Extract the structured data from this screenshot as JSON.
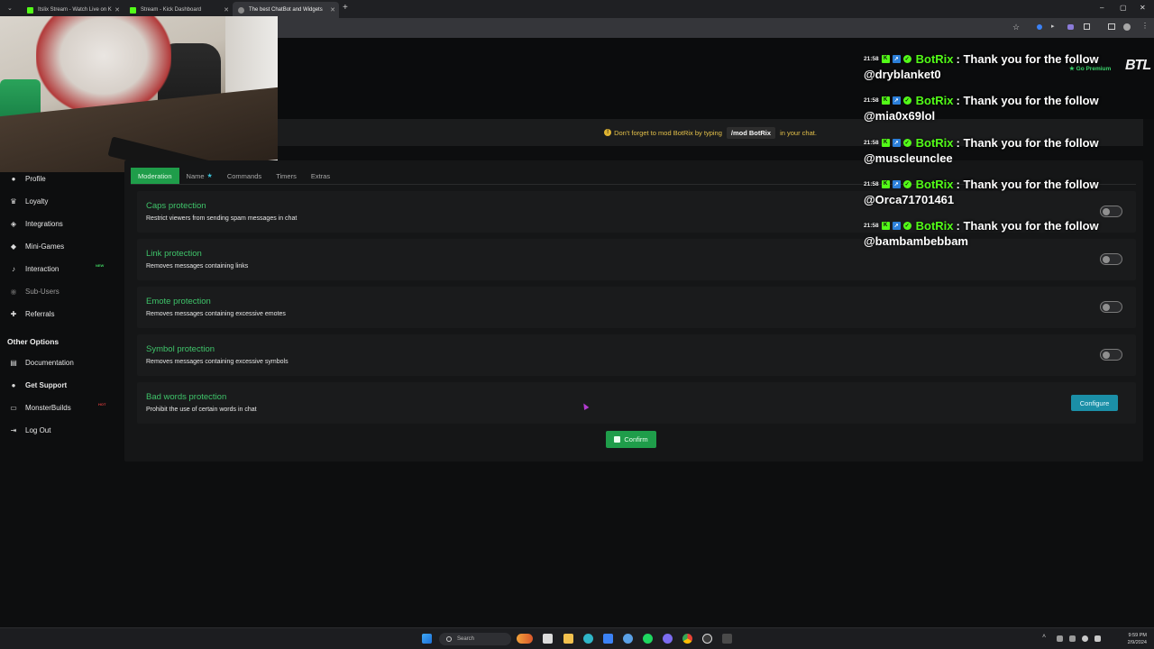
{
  "browser": {
    "tabs": [
      {
        "label": "Itslix Stream - Watch Live on K",
        "color": "#53fc18"
      },
      {
        "label": "Stream - Kick Dashboard",
        "color": "#53fc18"
      },
      {
        "label": "The best ChatBot and Widgets",
        "color": "#888888"
      }
    ],
    "new_tab": "+",
    "window_controls": {
      "minimize": "–",
      "maximize": "▢",
      "close": "✕"
    }
  },
  "notice": {
    "prefix": "Don't forget to mod BotRix by typing",
    "command": "/mod BotRix",
    "suffix": "in your chat."
  },
  "sidebar": {
    "items": [
      {
        "label": "Profile",
        "icon": "user-icon",
        "glyph": "●"
      },
      {
        "label": "Loyalty",
        "icon": "trophy-icon",
        "glyph": "♛"
      },
      {
        "label": "Integrations",
        "icon": "plug-icon",
        "glyph": "◈"
      },
      {
        "label": "Mini-Games",
        "icon": "gamepad-icon",
        "glyph": "◆"
      },
      {
        "label": "Interaction",
        "icon": "music-icon",
        "glyph": "♪",
        "badge": "NEW"
      },
      {
        "label": "Sub-Users",
        "icon": "users-icon",
        "glyph": "◉"
      },
      {
        "label": "Referrals",
        "icon": "people-icon",
        "glyph": "✚"
      }
    ],
    "other_options_title": "Other Options",
    "other_items": [
      {
        "label": "Documentation",
        "icon": "book-icon",
        "glyph": "▤"
      },
      {
        "label": "Get Support",
        "icon": "support-icon",
        "glyph": "●"
      },
      {
        "label": "MonsterBuilds",
        "icon": "monitor-icon",
        "glyph": "▭",
        "badge": "HOT"
      },
      {
        "label": "Log Out",
        "icon": "logout-icon",
        "glyph": "⇥"
      }
    ]
  },
  "tabs": [
    {
      "label": "Moderation",
      "active": true
    },
    {
      "label": "Name",
      "star": "★"
    },
    {
      "label": "Commands"
    },
    {
      "label": "Timers"
    },
    {
      "label": "Extras"
    }
  ],
  "settings": [
    {
      "title": "Caps protection",
      "desc": "Restrict viewers from sending spam messages in chat",
      "control": "toggle",
      "enabled": false
    },
    {
      "title": "Link protection",
      "desc": "Removes messages containing links",
      "control": "toggle",
      "enabled": false
    },
    {
      "title": "Emote protection",
      "desc": "Removes messages containing excessive emotes",
      "control": "toggle",
      "enabled": false
    },
    {
      "title": "Symbol protection",
      "desc": "Removes messages containing excessive symbols",
      "control": "toggle",
      "enabled": false
    },
    {
      "title": "Bad words protection",
      "desc": "Prohibit the use of certain words in chat",
      "control": "button",
      "button_label": "Configure"
    }
  ],
  "confirm_label": "Confirm",
  "chat_overlay": {
    "messages": [
      {
        "time": "21:58",
        "user": "BotRix",
        "text": ": Thank you for the follow",
        "mention": "@dryblanket0"
      },
      {
        "time": "21:58",
        "user": "BotRix",
        "text": ": Thank you for the follow",
        "mention": "@mia0x69lol"
      },
      {
        "time": "21:58",
        "user": "BotRix",
        "text": ": Thank you for the follow",
        "mention": "@muscleunclee"
      },
      {
        "time": "21:58",
        "user": "BotRix",
        "text": ": Thank you for the follow",
        "mention": "@Orca71701461"
      },
      {
        "time": "21:58",
        "user": "BotRix",
        "text": ": Thank you for the follow",
        "mention": "@bambambebbam"
      }
    ],
    "go_premium": "★ Go Premium",
    "logo": "BTL"
  },
  "taskbar": {
    "search_placeholder": "Search",
    "time": "9:59 PM",
    "date": "2/9/2024"
  },
  "colors": {
    "accent": "#1f9d4a",
    "title_green": "#3fc46a",
    "kick_green": "#53fc18",
    "configure": "#1b8fa7",
    "warning": "#e3c04a"
  }
}
